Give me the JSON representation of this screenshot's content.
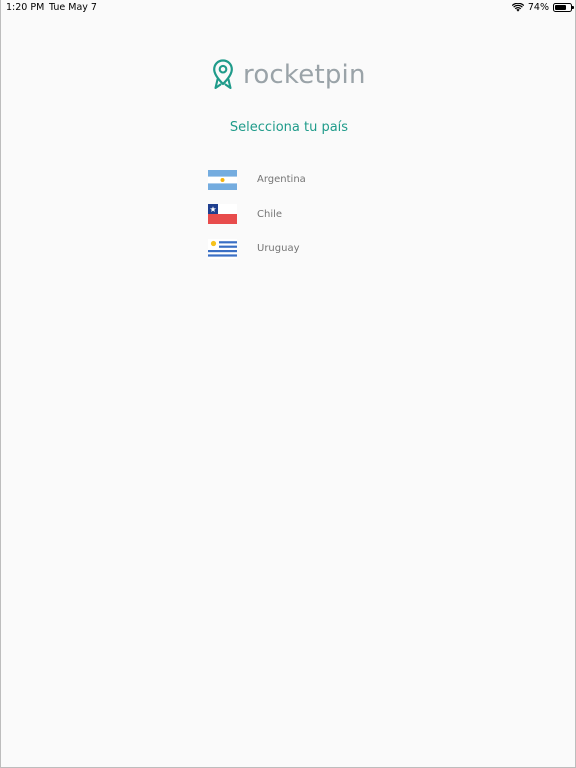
{
  "status_bar": {
    "time": "1:20 PM",
    "date": "Tue May 7",
    "battery": "74%",
    "battery_level": 0.74
  },
  "logo": {
    "text": "rocketpin",
    "icon": "rocket-pin-icon"
  },
  "heading": "Selecciona tu país",
  "countries": [
    {
      "label": "Argentina",
      "flag": "argentina-flag-icon"
    },
    {
      "label": "Chile",
      "flag": "chile-flag-icon"
    },
    {
      "label": "Uruguay",
      "flag": "uruguay-flag-icon"
    }
  ],
  "colors": {
    "accent": "#1f9b8a",
    "logo_text": "#9aa3a8",
    "country_text": "#757575",
    "background": "#fafafa"
  }
}
